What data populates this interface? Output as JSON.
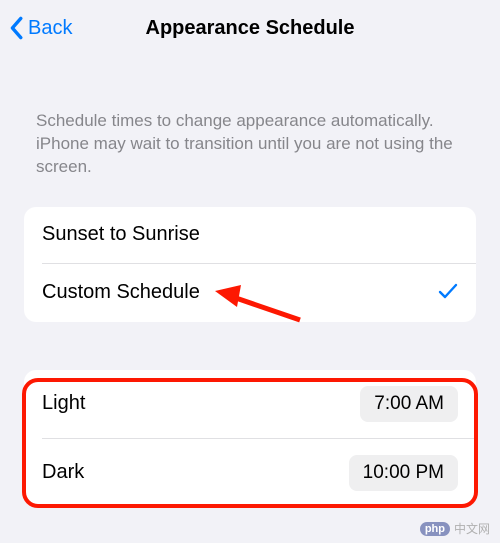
{
  "nav": {
    "back_label": "Back",
    "title": "Appearance Schedule"
  },
  "description": "Schedule times to change appearance automatically. iPhone may wait to transition until you are not using the screen.",
  "schedule_options": {
    "sunset": {
      "label": "Sunset to Sunrise"
    },
    "custom": {
      "label": "Custom Schedule"
    }
  },
  "times": {
    "light": {
      "label": "Light",
      "value": "7:00 AM"
    },
    "dark": {
      "label": "Dark",
      "value": "10:00 PM"
    }
  },
  "watermark": {
    "badge": "php",
    "text": "中文网"
  }
}
